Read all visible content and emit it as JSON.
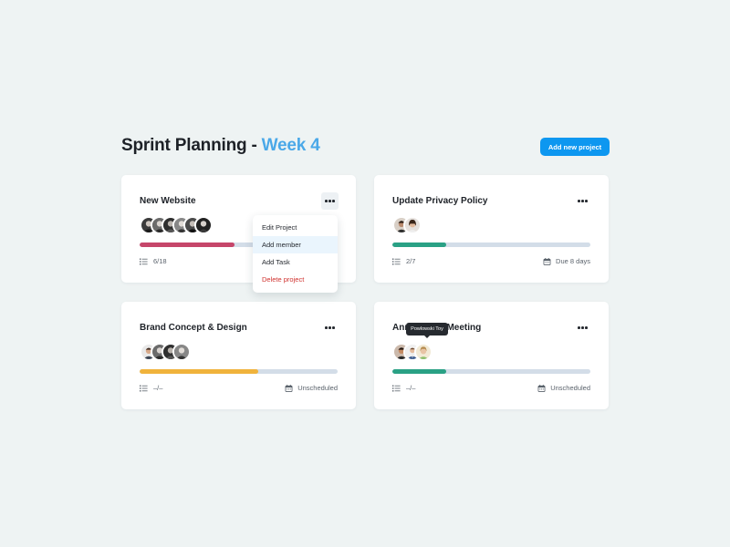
{
  "header": {
    "title_main": "Sprint Planning - ",
    "title_accent": "Week 4",
    "add_button": "Add new project"
  },
  "colors": {
    "accent": "#4aa8e8",
    "button": "#0d97f0",
    "progress_red": "#c6466a",
    "progress_green": "#2aa185",
    "progress_yellow": "#f0b33c",
    "track": "#d3dde8"
  },
  "cards": [
    {
      "title": "New Website",
      "avatars": [
        "face-dark-1",
        "face-dark-2",
        "face-dark-3",
        "face-dark-4",
        "face-dark-5",
        "face-dark-6"
      ],
      "progress": 0.48,
      "progress_color": "#c6466a",
      "tasks": "6/18",
      "due": ""
    },
    {
      "title": "Update Privacy Policy",
      "avatars": [
        "face-man",
        "face-woman"
      ],
      "progress": 0.27,
      "progress_color": "#2aa185",
      "tasks": "2/7",
      "due": "Due 8 days"
    },
    {
      "title": "Brand Concept & Design",
      "avatars": [
        "face-light-1",
        "face-dark-2",
        "face-dark-3",
        "face-dark-4"
      ],
      "progress": 0.6,
      "progress_color": "#f0b33c",
      "tasks": "–/–",
      "due": "Unscheduled"
    },
    {
      "title_left": "Ann",
      "title_right": "Meeting",
      "avatars": [
        "face-man-2",
        "face-suit",
        "face-smile"
      ],
      "progress": 0.27,
      "progress_color": "#2aa185",
      "tasks": "–/–",
      "due": "Unscheduled"
    }
  ],
  "context_menu": {
    "items": [
      "Edit Project",
      "Add member",
      "Add Task",
      "Delete project"
    ]
  },
  "tooltip": "Powlowski Toy"
}
